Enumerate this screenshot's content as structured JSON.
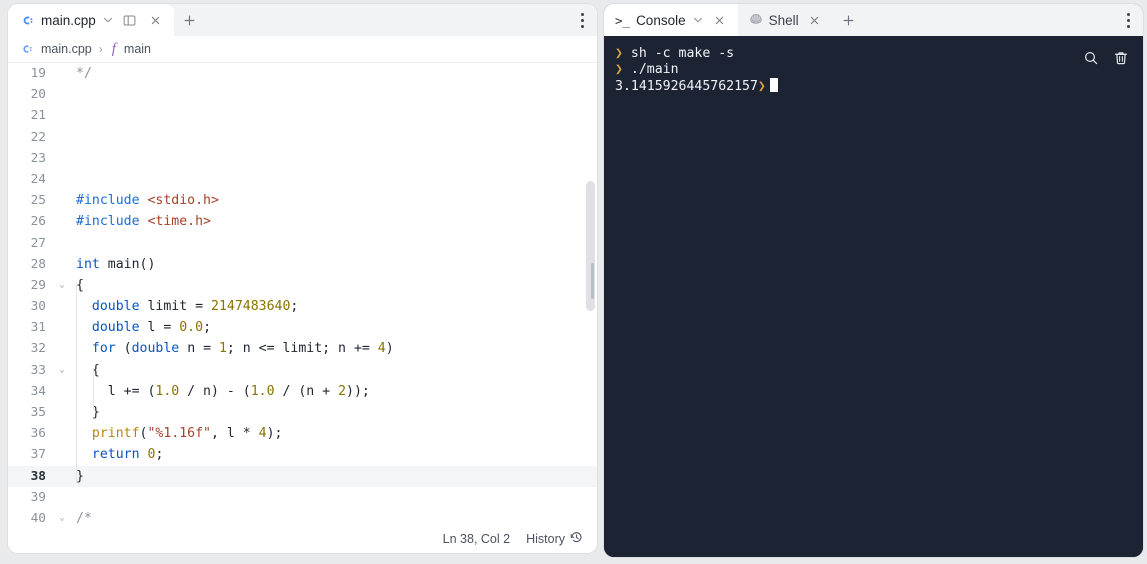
{
  "editor": {
    "tab": {
      "filename": "main.cpp",
      "file_icon": "cpp-file-icon",
      "chevron_icon": "chevron-down-icon",
      "split_icon": "split-editor-icon",
      "close_icon": "close-icon",
      "new_tab_icon": "plus-icon",
      "menu_icon": "kebab-menu-icon"
    },
    "breadcrumb": {
      "file": "main.cpp",
      "separator": "›",
      "function_icon": "f",
      "symbol": "main"
    },
    "status": {
      "cursor_position": "Ln 38, Col 2",
      "history_label": "History",
      "history_icon": "clock-rewind-icon"
    },
    "lines": [
      {
        "n": "19",
        "fold": "",
        "current": false,
        "tokens": [
          {
            "t": "*/",
            "c": "cm"
          }
        ]
      },
      {
        "n": "20",
        "fold": "",
        "current": false,
        "tokens": []
      },
      {
        "n": "21",
        "fold": "",
        "current": false,
        "tokens": []
      },
      {
        "n": "22",
        "fold": "",
        "current": false,
        "tokens": []
      },
      {
        "n": "23",
        "fold": "",
        "current": false,
        "tokens": []
      },
      {
        "n": "24",
        "fold": "",
        "current": false,
        "tokens": []
      },
      {
        "n": "25",
        "fold": "",
        "current": false,
        "tokens": [
          {
            "t": "#include",
            "c": "pp"
          },
          {
            "t": " ",
            "c": "pl"
          },
          {
            "t": "<stdio.h>",
            "c": "inc"
          }
        ]
      },
      {
        "n": "26",
        "fold": "",
        "current": false,
        "tokens": [
          {
            "t": "#include",
            "c": "pp"
          },
          {
            "t": " ",
            "c": "pl"
          },
          {
            "t": "<time.h>",
            "c": "inc"
          }
        ]
      },
      {
        "n": "27",
        "fold": "",
        "current": false,
        "tokens": []
      },
      {
        "n": "28",
        "fold": "",
        "current": false,
        "tokens": [
          {
            "t": "int",
            "c": "k"
          },
          {
            "t": " main()",
            "c": "pl"
          }
        ]
      },
      {
        "n": "29",
        "fold": "⌄",
        "current": false,
        "tokens": [
          {
            "t": "{",
            "c": "pl"
          }
        ]
      },
      {
        "n": "30",
        "fold": "",
        "current": false,
        "tokens": [
          {
            "t": "  ",
            "c": "pl"
          },
          {
            "t": "double",
            "c": "k"
          },
          {
            "t": " limit = ",
            "c": "pl"
          },
          {
            "t": "2147483640",
            "c": "num"
          },
          {
            "t": ";",
            "c": "pl"
          }
        ]
      },
      {
        "n": "31",
        "fold": "",
        "current": false,
        "tokens": [
          {
            "t": "  ",
            "c": "pl"
          },
          {
            "t": "double",
            "c": "k"
          },
          {
            "t": " l = ",
            "c": "pl"
          },
          {
            "t": "0.0",
            "c": "num"
          },
          {
            "t": ";",
            "c": "pl"
          }
        ]
      },
      {
        "n": "32",
        "fold": "",
        "current": false,
        "tokens": [
          {
            "t": "  ",
            "c": "pl"
          },
          {
            "t": "for",
            "c": "k"
          },
          {
            "t": " (",
            "c": "pl"
          },
          {
            "t": "double",
            "c": "k"
          },
          {
            "t": " n = ",
            "c": "pl"
          },
          {
            "t": "1",
            "c": "num"
          },
          {
            "t": "; n <= limit; n += ",
            "c": "pl"
          },
          {
            "t": "4",
            "c": "num"
          },
          {
            "t": ")",
            "c": "pl"
          }
        ]
      },
      {
        "n": "33",
        "fold": "⌄",
        "current": false,
        "tokens": [
          {
            "t": "  {",
            "c": "pl"
          }
        ]
      },
      {
        "n": "34",
        "fold": "",
        "current": false,
        "tokens": [
          {
            "t": "    l += (",
            "c": "pl"
          },
          {
            "t": "1.0",
            "c": "num"
          },
          {
            "t": " / n) - (",
            "c": "pl"
          },
          {
            "t": "1.0",
            "c": "num"
          },
          {
            "t": " / (n + ",
            "c": "pl"
          },
          {
            "t": "2",
            "c": "num"
          },
          {
            "t": "));",
            "c": "pl"
          }
        ]
      },
      {
        "n": "35",
        "fold": "",
        "current": false,
        "tokens": [
          {
            "t": "  }",
            "c": "pl"
          }
        ]
      },
      {
        "n": "36",
        "fold": "",
        "current": false,
        "tokens": [
          {
            "t": "  ",
            "c": "pl"
          },
          {
            "t": "printf",
            "c": "fn"
          },
          {
            "t": "(",
            "c": "pl"
          },
          {
            "t": "\"%1.16f\"",
            "c": "str"
          },
          {
            "t": ", l * ",
            "c": "pl"
          },
          {
            "t": "4",
            "c": "num"
          },
          {
            "t": ");",
            "c": "pl"
          }
        ]
      },
      {
        "n": "37",
        "fold": "",
        "current": false,
        "tokens": [
          {
            "t": "  ",
            "c": "pl"
          },
          {
            "t": "return",
            "c": "k"
          },
          {
            "t": " ",
            "c": "pl"
          },
          {
            "t": "0",
            "c": "num"
          },
          {
            "t": ";",
            "c": "pl"
          }
        ]
      },
      {
        "n": "38",
        "fold": "",
        "current": true,
        "tokens": [
          {
            "t": "}",
            "c": "pl"
          }
        ]
      },
      {
        "n": "39",
        "fold": "",
        "current": false,
        "tokens": []
      },
      {
        "n": "40",
        "fold": "⌄",
        "current": false,
        "tokens": [
          {
            "t": "/*",
            "c": "cm"
          }
        ]
      }
    ]
  },
  "console": {
    "tabs": [
      {
        "label": "Console",
        "icon": "terminal-prompt-icon",
        "active": true,
        "has_chevron": true,
        "closable": true
      },
      {
        "label": "Shell",
        "icon": "shell-icon",
        "active": false,
        "has_chevron": false,
        "closable": true
      }
    ],
    "new_tab_icon": "plus-icon",
    "menu_icon": "kebab-menu-icon",
    "actions": {
      "search_icon": "search-icon",
      "clear_icon": "trash-icon"
    },
    "output": [
      {
        "prompt": "❯",
        "text": "sh -c make -s",
        "kind": "command"
      },
      {
        "prompt": "❯",
        "text": "./main",
        "kind": "command"
      },
      {
        "prompt": "",
        "text": "3.1415926445762157",
        "kind": "output",
        "trailing_prompt": "❯",
        "cursor": true
      }
    ]
  },
  "colors": {
    "page_bg": "#e9eaec",
    "panel_bg": "#ffffff",
    "tabbar_bg": "#f2f3f5",
    "console_bg": "#1c2333",
    "keyword": "#0a54c4",
    "number": "#8a7200",
    "string": "#a6412a",
    "function": "#b8860b",
    "prompt_arrow": "#d8a13a",
    "cpp_icon": "#4b8bf5"
  }
}
